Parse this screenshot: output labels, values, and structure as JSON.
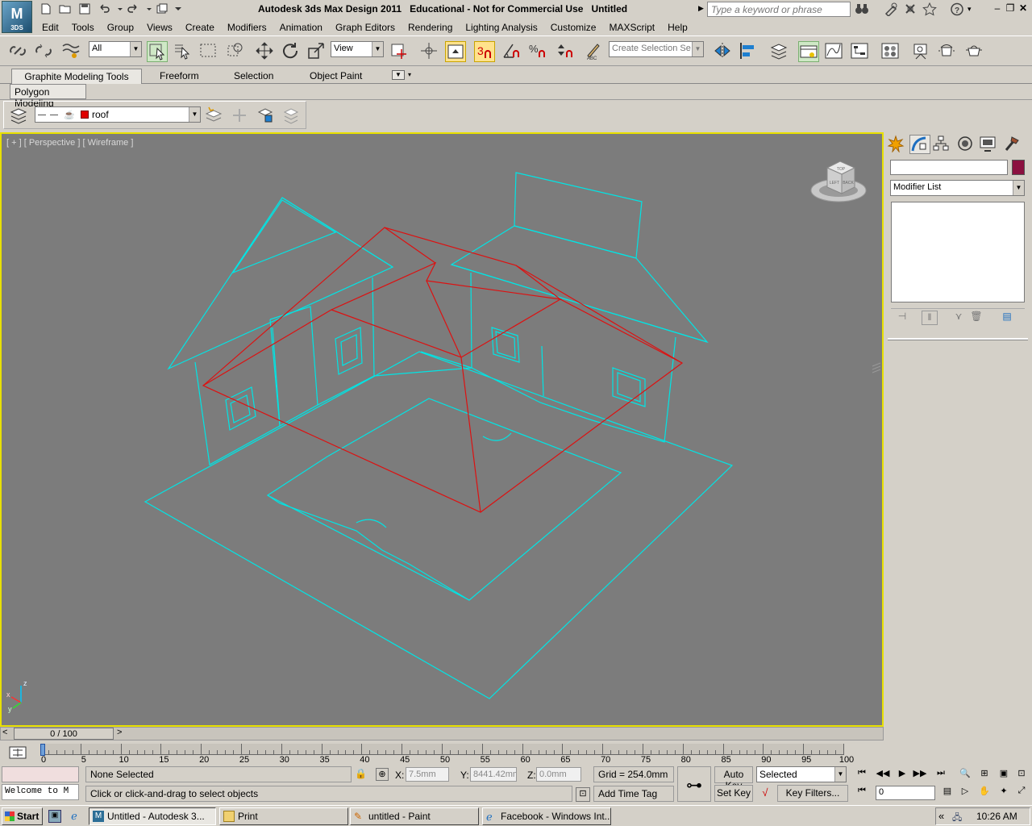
{
  "app": {
    "logo_text": "3DS",
    "title": "Autodesk 3ds Max Design 2011   Educational - Not for Commercial Use   Untitled",
    "search_placeholder": "Type a keyword or phrase"
  },
  "menu": [
    "Edit",
    "Tools",
    "Group",
    "Views",
    "Create",
    "Modifiers",
    "Animation",
    "Graph Editors",
    "Rendering",
    "Lighting Analysis",
    "Customize",
    "MAXScript",
    "Help"
  ],
  "main_toolbar": {
    "selection_filter": "All",
    "ref_coord": "View",
    "snap_value": "3",
    "named_selection_placeholder": "Create Selection Se"
  },
  "ribbon": {
    "tabs": [
      "Graphite Modeling Tools",
      "Freeform",
      "Selection",
      "Object Paint"
    ],
    "subtab": "Polygon Modeling"
  },
  "layer_toolbar": {
    "current_layer": "roof",
    "layer_color": "#e00000"
  },
  "viewport": {
    "label": "[ + ] [ Perspective ] [ Wireframe ]",
    "viewcube_faces": [
      "TOP",
      "BACK",
      "LEFT"
    ],
    "axis_labels": [
      "z",
      "x",
      "y"
    ],
    "wire_color": "#00e5e5",
    "selected_wire_color": "#dd1111",
    "background": "#7c7c7c"
  },
  "command_panel": {
    "modifier_list": "Modifier List",
    "object_color": "#8b1040"
  },
  "time_slider": {
    "position": "0 / 100",
    "prev": "<",
    "next": ">"
  },
  "trackbar_labels": [
    "0",
    "5",
    "10",
    "15",
    "20",
    "25",
    "30",
    "35",
    "40",
    "45",
    "50",
    "55",
    "60",
    "65",
    "70",
    "75",
    "80",
    "85",
    "90",
    "95",
    "100"
  ],
  "status": {
    "maxscript_listener": "Welcome to M",
    "selection": "None Selected",
    "prompt": "Click or click-and-drag to select objects",
    "x_label": "X:",
    "x_value": "7.5mm",
    "y_label": "Y:",
    "y_value": "8441.42mm",
    "z_label": "Z:",
    "z_value": "0.0mm",
    "grid": "Grid = 254.0mm",
    "add_time_tag": "Add Time Tag",
    "auto_key": "Auto Key",
    "set_key": "Set Key",
    "key_mode": "Selected",
    "key_filters": "Key Filters...",
    "current_frame": "0"
  },
  "taskbar": {
    "start": "Start",
    "tasks": [
      "Untitled - Autodesk 3...",
      "Print",
      "untitled - Paint",
      "Facebook - Windows Int..."
    ],
    "clock": "10:26 AM",
    "tray_arrow": "«"
  }
}
